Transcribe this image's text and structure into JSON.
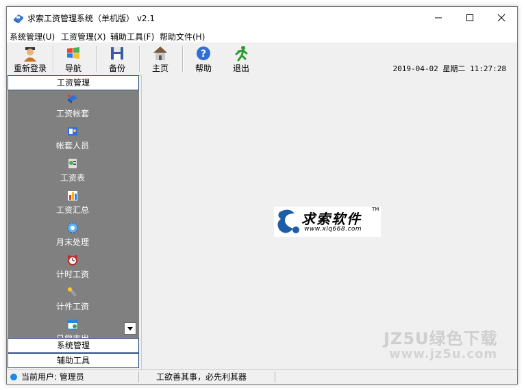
{
  "window": {
    "title": "求索工资管理系统（单机版） v2.1",
    "controls": {
      "minimize": "─",
      "maximize": "☐",
      "close": "✕"
    }
  },
  "menu": [
    {
      "label": "系统管理(U)"
    },
    {
      "label": "工资管理(X)"
    },
    {
      "label": "辅助工具(F)"
    },
    {
      "label": "帮助文件(H)"
    }
  ],
  "toolbar": {
    "buttons": [
      {
        "label": "重新登录",
        "icon": "user-icon"
      },
      {
        "label": "导航",
        "icon": "windows-flag-icon"
      },
      {
        "label": "备份",
        "icon": "floppy-disk-icon"
      },
      {
        "label": "主页",
        "icon": "home-icon"
      },
      {
        "label": "帮助",
        "icon": "help-icon"
      },
      {
        "label": "退出",
        "icon": "running-man-icon"
      }
    ],
    "datetime": "2019-04-02 星期二 11:27:28"
  },
  "nav": {
    "section_title": "工资管理",
    "items": [
      {
        "label": "工资帐套",
        "icon": "book-icon"
      },
      {
        "label": "帐套人员",
        "icon": "personnel-card-icon"
      },
      {
        "label": "工资表",
        "icon": "salary-table-icon"
      },
      {
        "label": "工资汇总",
        "icon": "bar-chart-icon"
      },
      {
        "label": "月末处理",
        "icon": "gear-globe-icon"
      },
      {
        "label": "计时工资",
        "icon": "alarm-clock-icon"
      },
      {
        "label": "计件工资",
        "icon": "wrench-icon"
      },
      {
        "label": "日常支出",
        "icon": "calendar-icon"
      }
    ],
    "other_sections": [
      {
        "label": "系统管理"
      },
      {
        "label": "辅助工具"
      }
    ]
  },
  "logo": {
    "title": "求索软件",
    "tm": "TM",
    "url": "www.xlq668.com"
  },
  "status": {
    "current_user": "当前用户: 管理员",
    "motto": "工欲善其事，必先利其器"
  },
  "watermark": {
    "main": "JZ5U绿色下载",
    "sub": "www.jz5u.com"
  },
  "colors": {
    "nav_bg": "#808080",
    "header_border": "#2b4f80",
    "logo_blue": "#1c5fa8"
  }
}
